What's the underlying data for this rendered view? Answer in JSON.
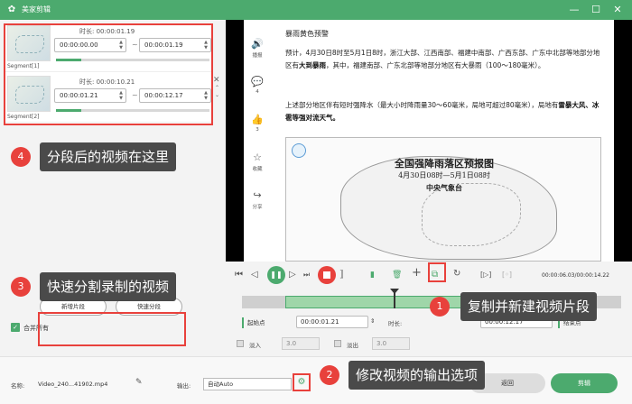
{
  "window": {
    "title": "美家剪辑",
    "logo_glyph": "✿",
    "minimize": "—",
    "maximize": "☐",
    "close": "✕"
  },
  "segments": [
    {
      "label": "Segment[1]",
      "duration_label": "时长:",
      "duration": "00:00:01.19",
      "start": "00:00:00.00",
      "end": "00:00:01.19"
    },
    {
      "label": "Segment[2]",
      "duration_label": "时长:",
      "duration": "00:00:10.21",
      "start": "00:00:01.21",
      "end": "00:00:12.17"
    }
  ],
  "segment_close_glyph": "✕",
  "segment_dash": "~",
  "list_scroll_glyphs": "⌃\n⌄",
  "split_buttons": {
    "new_segment": "新增片段",
    "quick_split": "快速分段"
  },
  "merge_all": {
    "checked": true,
    "check_glyph": "✓",
    "label": "合并所有"
  },
  "annotations": [
    {
      "num": "1",
      "text": "复制并新建视频片段"
    },
    {
      "num": "2",
      "text": "修改视频的输出选项"
    },
    {
      "num": "3",
      "text": "快速分割录制的视频"
    },
    {
      "num": "4",
      "text": "分段后的视频在这里"
    }
  ],
  "social_sidebar": [
    {
      "icon": "🔊",
      "label": "播报"
    },
    {
      "icon": "💬",
      "label": "4"
    },
    {
      "icon": "👍",
      "label": "3"
    },
    {
      "icon": "☆",
      "label": "收藏"
    },
    {
      "icon": "↪",
      "label": "分享"
    }
  ],
  "article": {
    "heading": "暴雨黄色预警",
    "para1_pre": "预计，4月30日8时至5月1日8时，浙江大部、江西南部、福建中南部、广西东部、广东中北部等地部分地区有",
    "para1_bold": "大到暴雨",
    "para1_post": "，其中，福建南部、广东北部等地部分地区有大暴雨（100～180毫米）。",
    "para2_pre": "上述部分地区伴有短时强降水（最大小时降雨量30～60毫米，局地可超过80毫米），局地有",
    "para2_bold": "雷暴大风、冰雹等强对流天气。",
    "map_title": "全国强降雨落区预报图",
    "map_subtitle": "4月30日08时—5月1日08时",
    "map_source": "中央气象台"
  },
  "player": {
    "timecode": "00:00:06.03/00:00:14.22",
    "progress_fraction": 0.4,
    "start_point_label": "起始点",
    "start_time": "00:00:01.21",
    "duration_label": "时长:",
    "end_time": "00:00:12.17",
    "end_point_label": "结束点",
    "fade_in_label": "淡入",
    "fade_in_value": "3.0",
    "fade_out_label": "淡出",
    "fade_out_value": "3.0",
    "icons": {
      "prev": "⏮",
      "step_back": "◁",
      "play": "❚❚",
      "step_fwd": "▷",
      "next": "⏭",
      "trim": "⟧",
      "delete": "🗑",
      "add": "+",
      "copy": "⧉",
      "reset": "↻",
      "snap_l": "[▷]",
      "snap_r": "[◦]"
    }
  },
  "bottom": {
    "name_label": "名称:",
    "file_name": "Video_240...41902.mp4",
    "output_label": "输出:",
    "output_value": "自动Auto",
    "cancel_label": "返回",
    "export_label": "剪辑"
  }
}
